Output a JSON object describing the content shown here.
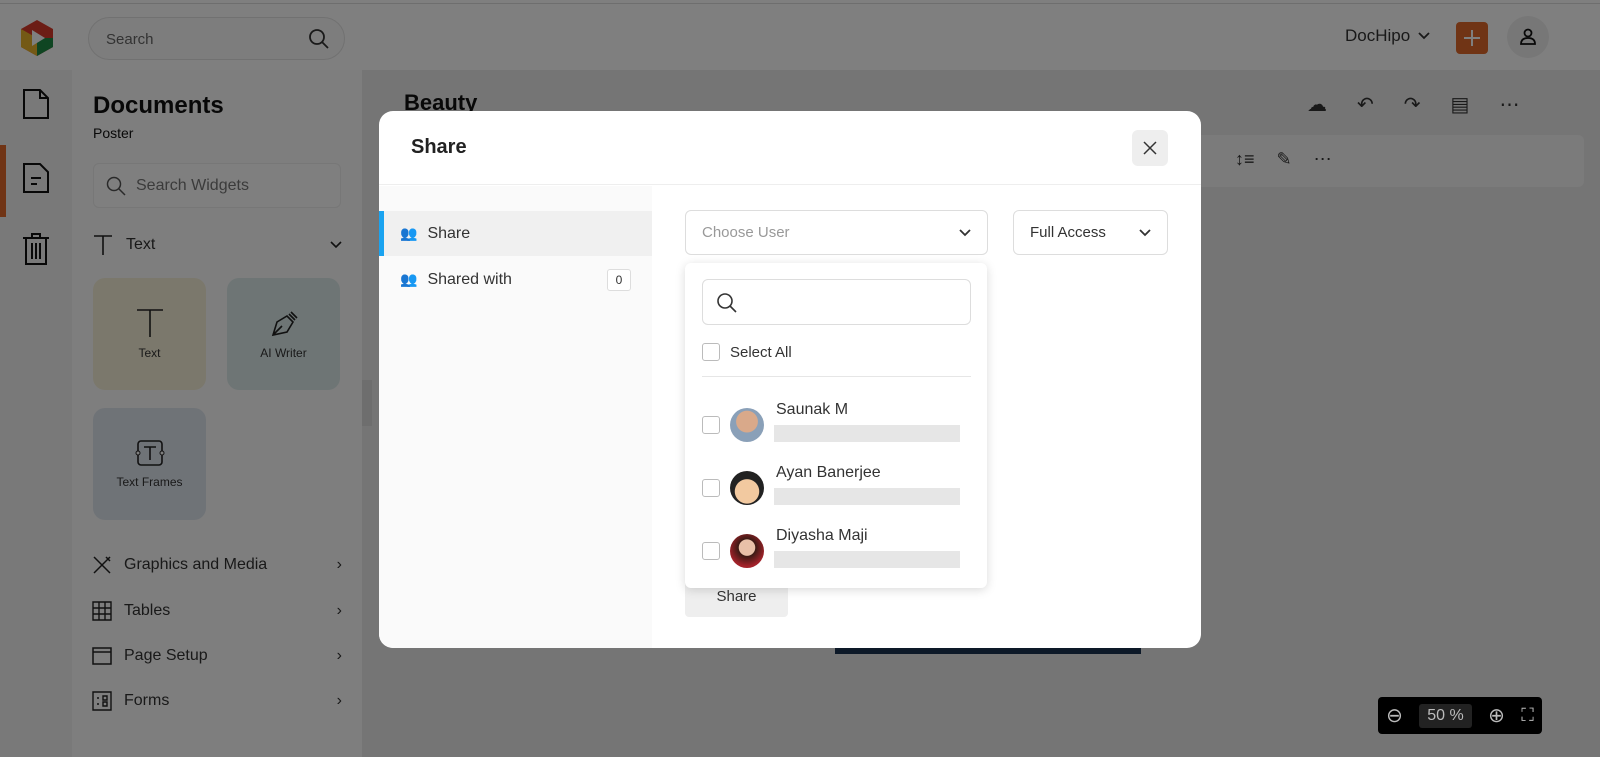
{
  "topbar": {
    "search_placeholder": "Search",
    "workspace": "DocHipo"
  },
  "panel": {
    "title": "Documents",
    "subtitle": "Poster",
    "search_placeholder": "Search Widgets",
    "section": "Text",
    "cards": [
      {
        "label": "Text"
      },
      {
        "label": "AI Writer"
      },
      {
        "label": "Text Frames"
      }
    ],
    "menu": [
      {
        "label": "Graphics and Media"
      },
      {
        "label": "Tables"
      },
      {
        "label": "Page Setup"
      },
      {
        "label": "Forms"
      }
    ]
  },
  "main": {
    "doc_title": "Beauty"
  },
  "zoom": {
    "value": "50",
    "unit": "%"
  },
  "modal": {
    "title": "Share",
    "tabs": [
      {
        "label": "Share"
      },
      {
        "label": "Shared with",
        "count": "0"
      }
    ],
    "choose_user_placeholder": "Choose User",
    "access": "Full Access",
    "share_button": "Share",
    "dropdown": {
      "select_all": "Select All",
      "users": [
        {
          "name": "Saunak M"
        },
        {
          "name": "Ayan Banerjee"
        },
        {
          "name": "Diyasha Maji"
        }
      ]
    }
  },
  "colors": {
    "brand": "#e0692a",
    "active_tab": "#1aa3f0"
  }
}
